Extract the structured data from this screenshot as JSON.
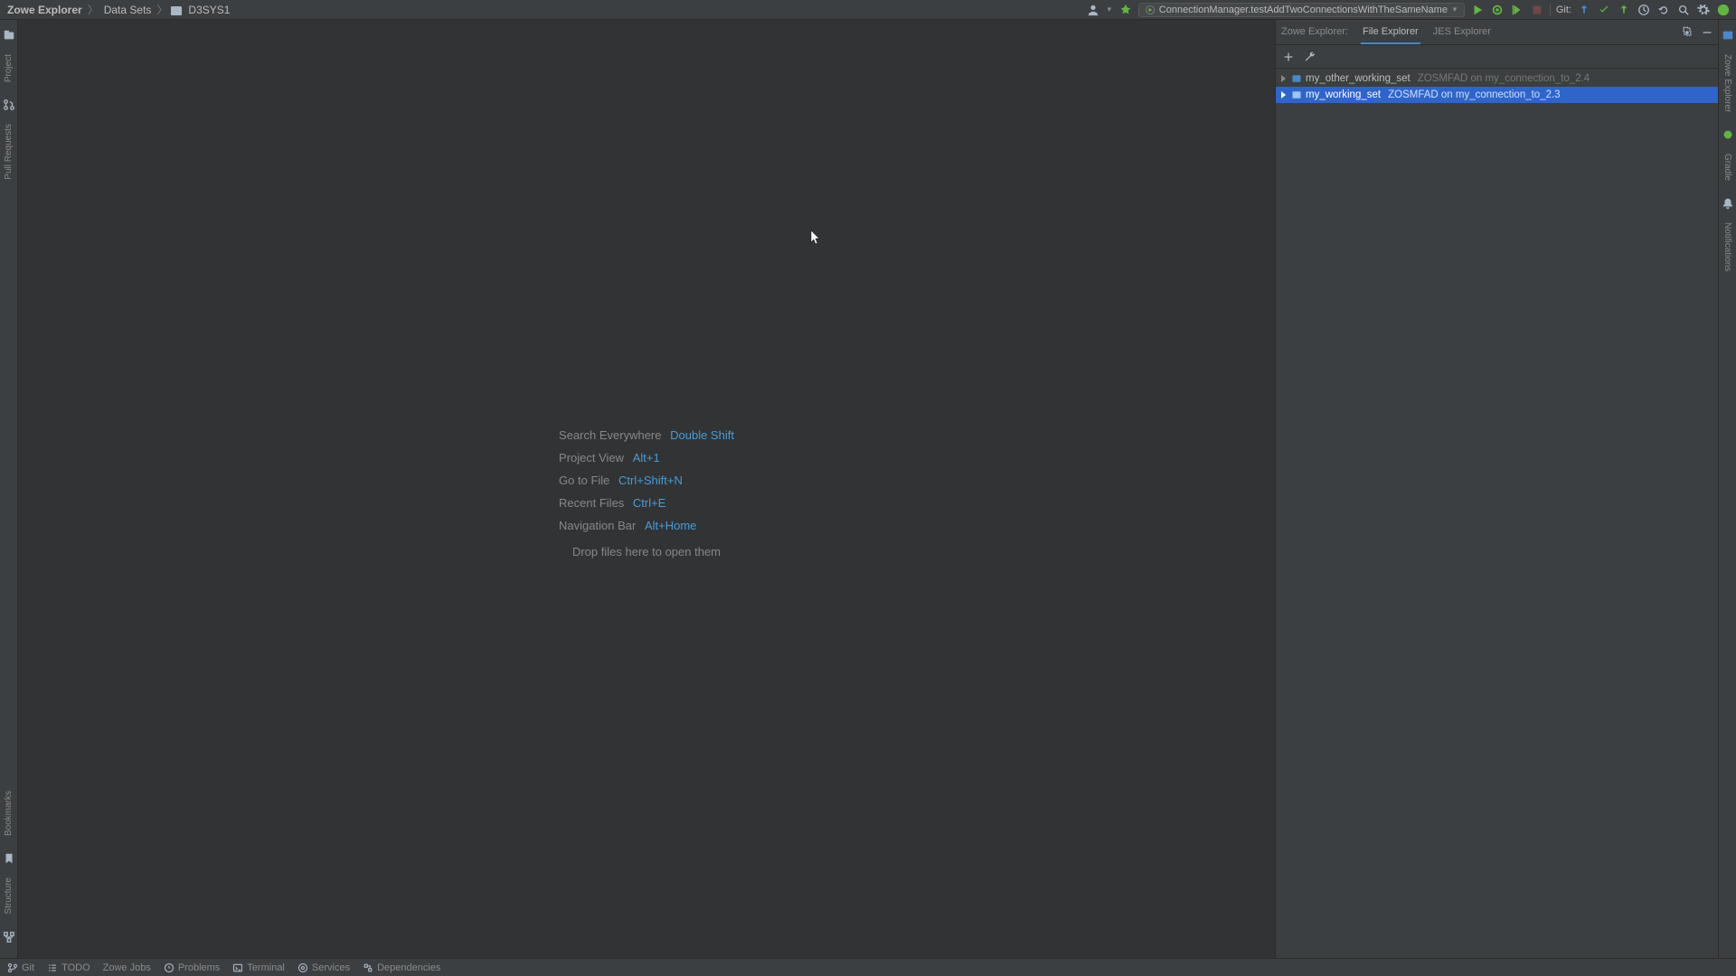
{
  "breadcrumbs": {
    "root": "Zowe Explorer",
    "section": "Data Sets",
    "leaf": "D3SYS1"
  },
  "run_config": {
    "label": "ConnectionManager.testAddTwoConnectionsWithTheSameName"
  },
  "git_label": "Git:",
  "left_gutter": {
    "project": "Project",
    "pull_requests": "Pull Requests",
    "bookmarks": "Bookmarks",
    "structure": "Structure"
  },
  "right_gutter": {
    "zowe_explorer": "Zowe Explorer",
    "gradle": "Gradle",
    "notifications": "Notifications"
  },
  "hints": {
    "search_everywhere": {
      "label": "Search Everywhere",
      "key": "Double Shift"
    },
    "project_view": {
      "label": "Project View",
      "key": "Alt+1"
    },
    "go_to_file": {
      "label": "Go to File",
      "key": "Ctrl+Shift+N"
    },
    "recent_files": {
      "label": "Recent Files",
      "key": "Ctrl+E"
    },
    "navigation_bar": {
      "label": "Navigation Bar",
      "key": "Alt+Home"
    },
    "drop": "Drop files here to open them"
  },
  "side_panel": {
    "tabs": {
      "zowe": "Zowe Explorer:",
      "file": "File Explorer",
      "jes": "JES Explorer"
    },
    "items": [
      {
        "name": "my_other_working_set",
        "conn": "ZOSMFAD on my_connection_to_2.4",
        "selected": false
      },
      {
        "name": "my_working_set",
        "conn": "ZOSMFAD on my_connection_to_2.3",
        "selected": true
      }
    ]
  },
  "bottom": {
    "git": "Git",
    "todo": "TODO",
    "zowe_jobs": "Zowe Jobs",
    "problems": "Problems",
    "terminal": "Terminal",
    "services": "Services",
    "dependencies": "Dependencies"
  }
}
